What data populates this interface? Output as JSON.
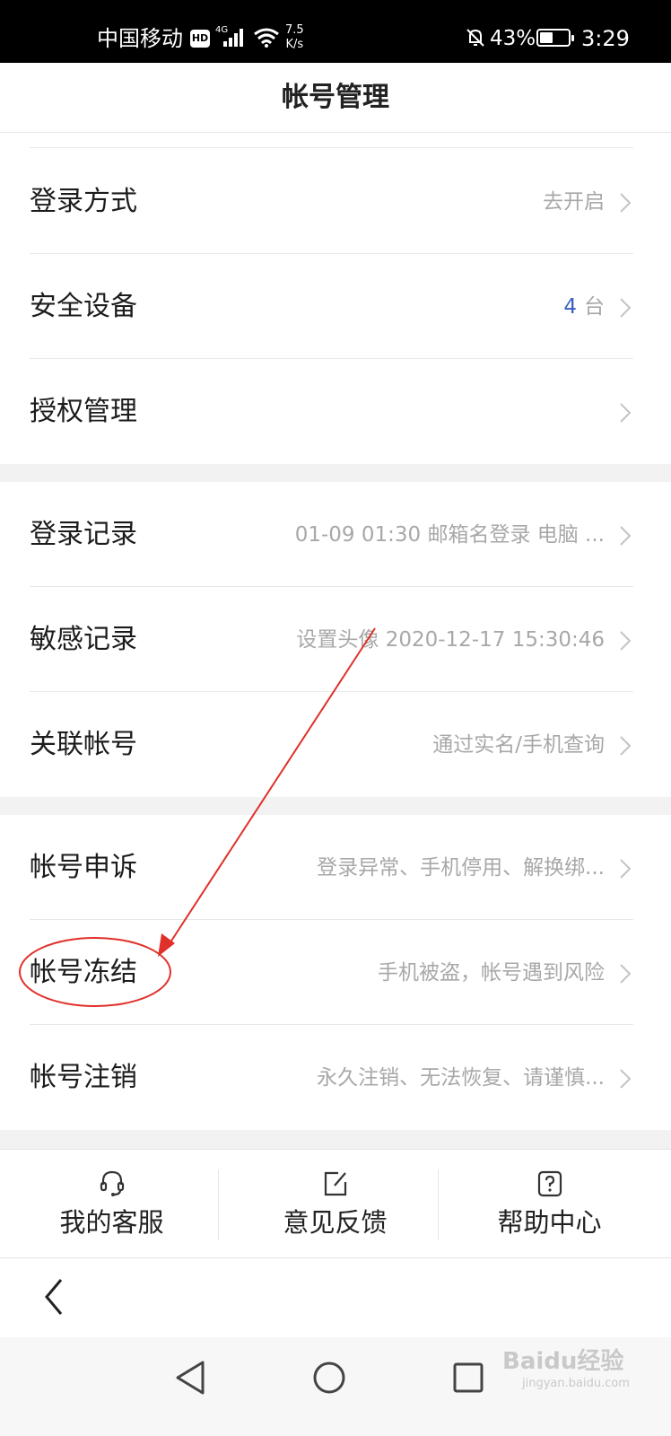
{
  "status_bar": {
    "carrier": "中国移动",
    "hd_badge": "HD",
    "network": "4G",
    "speed_value": "7.5",
    "speed_unit": "K/s",
    "battery": "43%",
    "time": "3:29",
    "icons": [
      "signal-icon",
      "wifi-icon",
      "bell-muted-icon",
      "battery-icon"
    ]
  },
  "header": {
    "title": "帐号管理"
  },
  "groups": [
    {
      "rows": [
        {
          "label": "登录方式",
          "value": "去开启"
        },
        {
          "label": "安全设备",
          "count": "4",
          "value": "台"
        },
        {
          "label": "授权管理",
          "value": ""
        }
      ]
    },
    {
      "rows": [
        {
          "label": "登录记录",
          "value": "01-09 01:30 邮箱名登录 电脑 ..."
        },
        {
          "label": "敏感记录",
          "value": "设置头像 2020-12-17 15:30:46"
        },
        {
          "label": "关联帐号",
          "value": "通过实名/手机查询"
        }
      ]
    },
    {
      "rows": [
        {
          "label": "帐号申诉",
          "value": "登录异常、手机停用、解换绑..."
        },
        {
          "label": "帐号冻结",
          "value": "手机被盗，帐号遇到风险"
        },
        {
          "label": "帐号注销",
          "value": "永久注销、无法恢复、请谨慎..."
        }
      ]
    }
  ],
  "actions": [
    {
      "label": "我的客服",
      "icon": "headset-icon"
    },
    {
      "label": "意见反馈",
      "icon": "edit-icon"
    },
    {
      "label": "帮助中心",
      "icon": "help-icon"
    }
  ],
  "watermark": {
    "brand": "Baidu经验",
    "url": "jingyan.baidu.com"
  },
  "colors": {
    "accent": "#3b5fc0",
    "annotation": "#e0302a",
    "muted_text": "#a8a8a8"
  }
}
